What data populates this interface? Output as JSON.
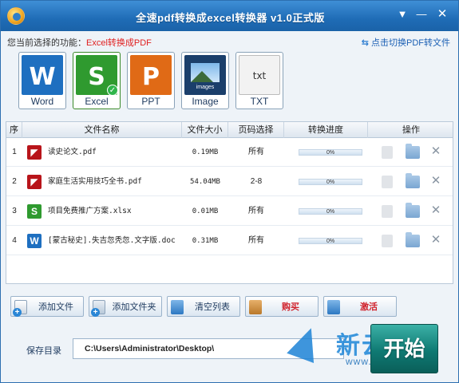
{
  "window": {
    "title": "全速pdf转换成excel转换器 v1.0正式版",
    "menu_icon": "dropdown-menu-icon",
    "min_glyph": "—",
    "close_glyph": "✕"
  },
  "function_bar": {
    "label": "您当前选择的功能：",
    "selected": "Excel转换成PDF",
    "switch_link": "点击切换PDF转文件",
    "switch_icon": "⇆"
  },
  "formats": [
    {
      "label": "Word",
      "glyph": "W",
      "icon": "word-icon"
    },
    {
      "label": "Excel",
      "glyph": "S",
      "icon": "excel-icon",
      "selected": true
    },
    {
      "label": "PPT",
      "glyph": "P",
      "icon": "ppt-icon"
    },
    {
      "label": "Image",
      "glyph": "",
      "caption": "images",
      "icon": "image-icon"
    },
    {
      "label": "TXT",
      "glyph": "txt",
      "icon": "txt-icon"
    }
  ],
  "table": {
    "columns": [
      "序",
      "文件名称",
      "文件大小",
      "页码选择",
      "转换进度",
      "操作"
    ],
    "rows": [
      {
        "no": "1",
        "name": "读史论文.pdf",
        "type": "pdf",
        "glyph": "◤",
        "size": "0.19MB",
        "pages": "所有",
        "progress": "0%"
      },
      {
        "no": "2",
        "name": "家庭生活实用技巧全书.pdf",
        "type": "pdf",
        "glyph": "◤",
        "size": "54.04MB",
        "pages": "2-8",
        "progress": "0%"
      },
      {
        "no": "3",
        "name": "项目免费推广方案.xlsx",
        "type": "xlsx",
        "glyph": "S",
        "size": "0.01MB",
        "pages": "所有",
        "progress": "0%"
      },
      {
        "no": "4",
        "name": "[蒙古秘史].失吉忽秃忽.文字版.doc",
        "type": "doc",
        "glyph": "W",
        "size": "0.31MB",
        "pages": "所有",
        "progress": "0%"
      }
    ],
    "delete_glyph": "✕"
  },
  "buttons": {
    "add_file": "添加文件",
    "add_folder": "添加文件夹",
    "clear_list": "清空列表",
    "buy": "购买",
    "activate": "激活",
    "plus_glyph": "+"
  },
  "save": {
    "label": "保存目录",
    "path": "C:\\Users\\Administrator\\Desktop\\",
    "start": "开始"
  },
  "watermark": {
    "text": "新云下载",
    "url": "www.newasp.net"
  }
}
